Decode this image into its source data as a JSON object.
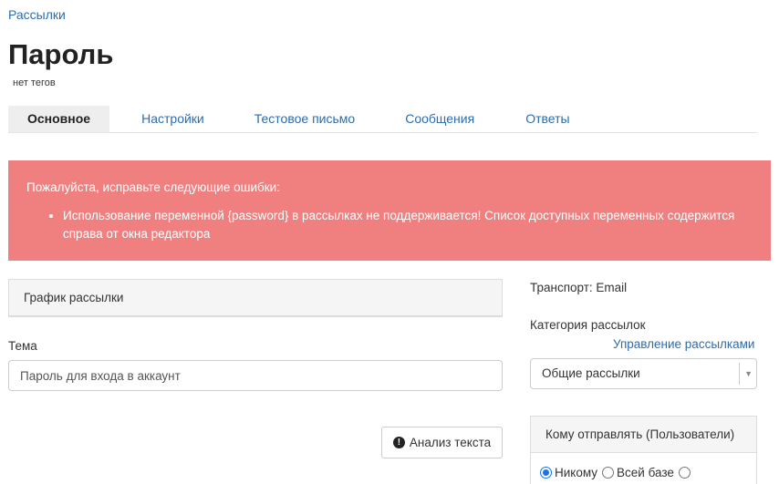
{
  "breadcrumb": "Рассылки",
  "title": "Пароль",
  "tags": "нет тегов",
  "tabs": [
    {
      "label": "Основное",
      "active": true
    },
    {
      "label": "Настройки"
    },
    {
      "label": "Тестовое письмо"
    },
    {
      "label": "Сообщения"
    },
    {
      "label": "Ответы"
    }
  ],
  "alert": {
    "title": "Пожалуйста, исправьте следующие ошибки:",
    "items": [
      "Использование переменной {password} в рассылках не поддерживается! Список доступных переменных содержится справа от окна редактора"
    ]
  },
  "schedule_panel": {
    "title": "График рассылки"
  },
  "subject": {
    "label": "Тема",
    "value": "Пароль для входа в аккаунт"
  },
  "analyze_button": {
    "label": "Анализ текста"
  },
  "transport": "Транспорт: Email",
  "category": {
    "label": "Категория рассылок",
    "manage_link": "Управление рассылками",
    "selected": "Общие рассылки"
  },
  "recipients": {
    "title": "Кому отправлять (Пользователи)",
    "options": [
      {
        "label": "Никому",
        "checked": true
      },
      {
        "label": "Всей базе",
        "checked": false
      },
      {
        "label": "",
        "checked": false
      }
    ]
  },
  "colors": {
    "accent": "#2a6db0",
    "alert_bg": "#f08080",
    "radio_checked": "#1a73e8"
  }
}
